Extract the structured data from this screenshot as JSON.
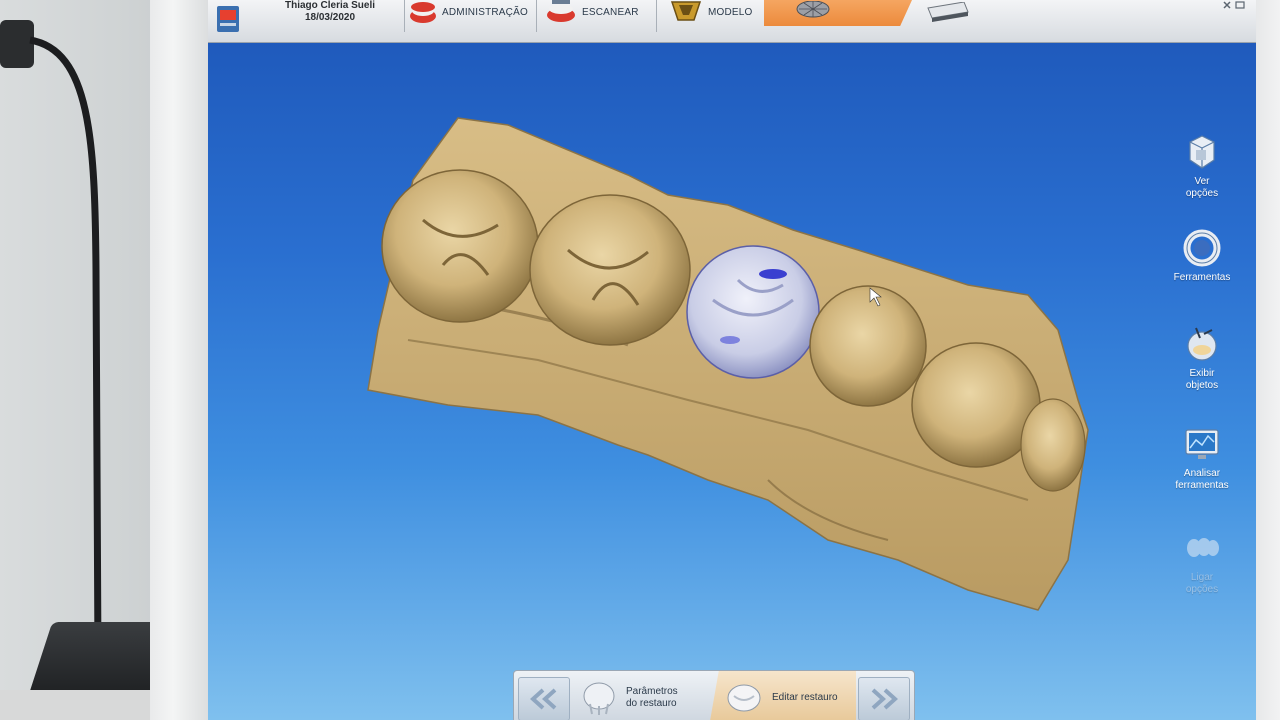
{
  "header": {
    "patient_name": "Thiago Cleria Sueli",
    "patient_date": "18/03/2020",
    "steps": [
      {
        "label": "ADMINISTRAÇÃO"
      },
      {
        "label": "ESCANEAR"
      },
      {
        "label": "MODELO"
      }
    ]
  },
  "right_tools": [
    {
      "line1": "Ver",
      "line2": "opções",
      "icon": "cube-icon"
    },
    {
      "line1": "Ferramentas",
      "line2": "",
      "icon": "ring-tool-icon"
    },
    {
      "line1": "Exibir",
      "line2": "objetos",
      "icon": "objects-icon"
    },
    {
      "line1": "Analisar",
      "line2": "ferramentas",
      "icon": "monitor-icon"
    },
    {
      "line1": "Ligar",
      "line2": "opções",
      "icon": "teeth-icon",
      "disabled": true
    }
  ],
  "bottom_nav": {
    "prev_label": "«",
    "next_label": "»",
    "steps": [
      {
        "line1": "Parâmetros",
        "line2": "do restauro"
      },
      {
        "line1": "Editar restauro",
        "line2": "",
        "active": true
      }
    ]
  },
  "colors": {
    "screen_top": "#1d56b8",
    "screen_bottom": "#7fc0ee",
    "active_step": "#ec8a3c",
    "model": "#d8bd86",
    "restoration": "#c9cde6"
  }
}
